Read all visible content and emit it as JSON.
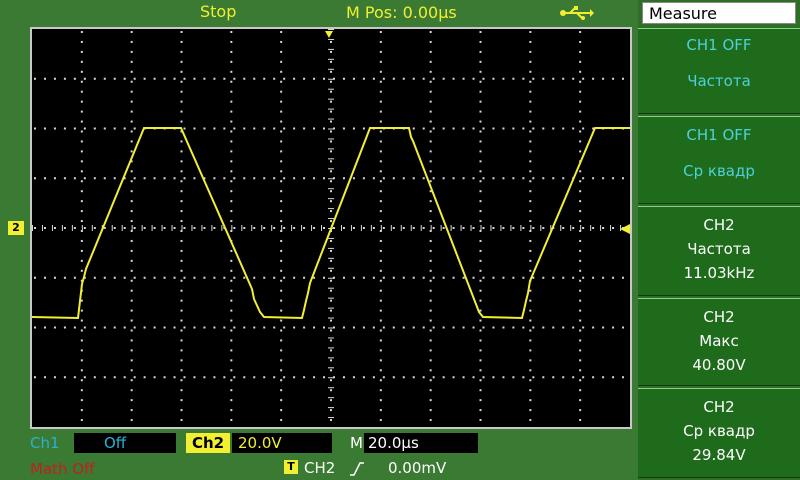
{
  "header": {
    "status": "Stop",
    "mpos": "M Pos: 0.00µs",
    "usb_icon": "usb-icon"
  },
  "channel_marker": "2",
  "bottom": {
    "ch1_label": "Ch1",
    "ch1_value": "Off",
    "ch2_label": "Ch2",
    "ch2_value": "20.0V",
    "time_label": "M",
    "time_value": "20.0µs",
    "math": "Math Off",
    "trigger_box": "T",
    "trigger_channel": "CH2",
    "trigger_level": "0.00mV"
  },
  "menu": {
    "title": "Measure",
    "items": [
      {
        "line1": "CH1  OFF",
        "line2": "Частота"
      },
      {
        "line1": "CH1  OFF",
        "line2": "Ср  квадр"
      },
      {
        "line1": "CH2",
        "line2": "Частота",
        "line3": "11.03kHz"
      },
      {
        "line1": "CH2",
        "line2": "Макс",
        "line3": "40.80V"
      },
      {
        "line1": "CH2",
        "line2": "Ср  квадр",
        "line3": "29.84V"
      }
    ]
  },
  "colors": {
    "trace": "#f2ef33",
    "ch1": "#2bb0d6",
    "math": "#c22020",
    "grid": "#d8d8d8",
    "screen_bg": "#000000"
  }
}
